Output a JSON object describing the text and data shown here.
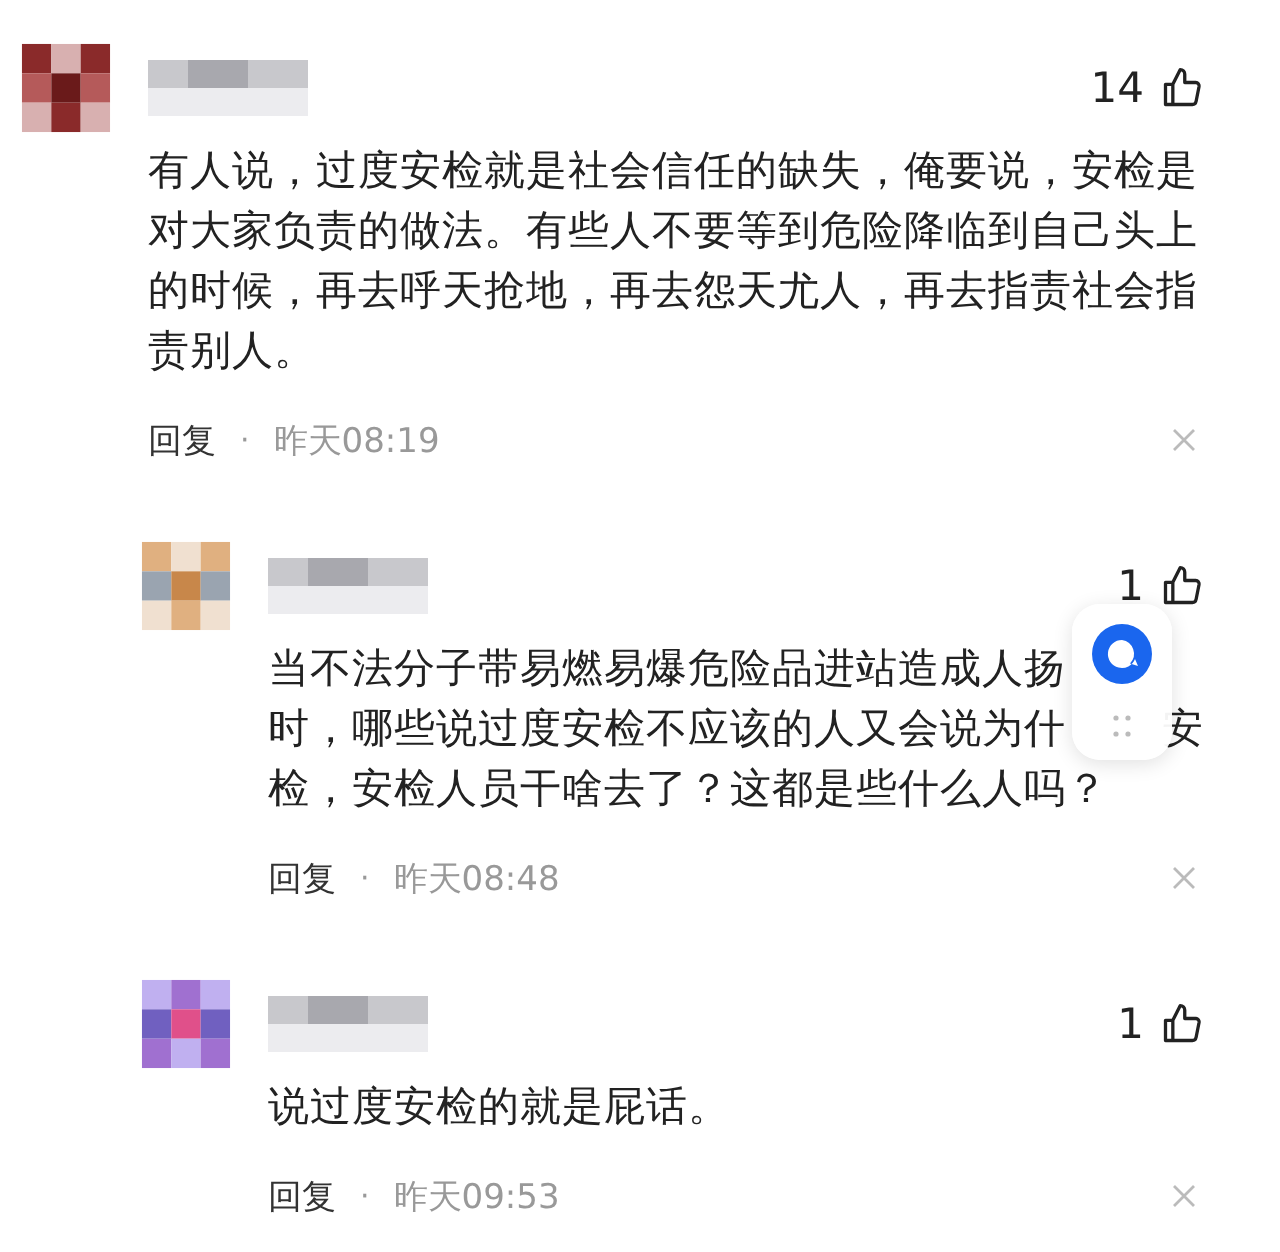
{
  "comments": [
    {
      "likes": "14",
      "lines": [
        [
          "有人说，过度安检就是社会信任的缺失，俺要说，安检是"
        ],
        [
          "对大家负责的做法。有些人不要等到危险降临到自己头上"
        ],
        [
          "的时候，再去呼天抢地，再去怨天尤人，再去指责社会指"
        ],
        [
          "责别人。"
        ]
      ],
      "reply": "回复",
      "dot": "·",
      "time": "昨天08:19",
      "nested": false
    },
    {
      "likes": "1",
      "lines": [
        [
          "当不法分子带易燃易爆危险品进站造成人扬"
        ],
        [
          "时，哪些说过度安检不应该的人又会说为什",
          "安"
        ],
        [
          "检，安检人员干啥去了？这都是些什么人吗？"
        ]
      ],
      "reply": "回复",
      "dot": "·",
      "time": "昨天08:48",
      "nested": true,
      "floating_button": true
    },
    {
      "likes": "1",
      "lines": [
        [
          "说过度安检的就是屁话。"
        ]
      ],
      "reply": "回复",
      "dot": "·",
      "time": "昨天09:53",
      "nested": true
    }
  ]
}
